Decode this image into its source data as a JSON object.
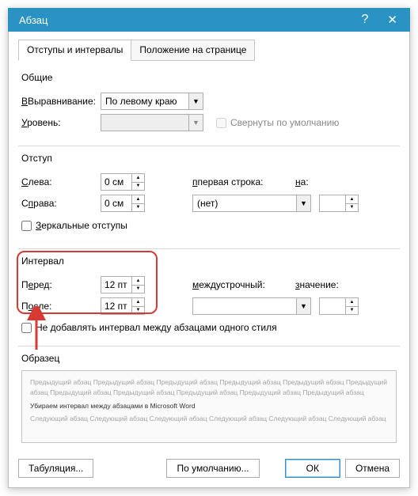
{
  "titlebar": {
    "title": "Абзац"
  },
  "tabs": {
    "t1": "Отступы и интервалы",
    "t2": "Положение на странице"
  },
  "general": {
    "legend": "Общие",
    "align_label": "Выравнивание:",
    "align_u": "В",
    "align_value": "По левому краю",
    "level_label": "ровень:",
    "level_u": "У",
    "level_value": "",
    "collapsed": "Свернуты по умолчанию"
  },
  "indent": {
    "legend": "Отступ",
    "left_label": "лева:",
    "left_u": "С",
    "left_value": "0 см",
    "right_label": "Справа:",
    "right_u": "п",
    "right_value": "0 см",
    "firstline_label": "первая строка:",
    "firstline_u": "п",
    "firstline_value": "(нет)",
    "by_label": "а:",
    "by_u": "н",
    "mirror": "еркальные отступы",
    "mirror_u": "З"
  },
  "spacing": {
    "legend": "Интервал",
    "before_label": "Перед:",
    "before_u": "е",
    "before_value": "12 пт",
    "after_label": "После:",
    "after_u": "о",
    "after_value": "12 пт",
    "line_label": "еждустрочный:",
    "line_u": "м",
    "line_value": "",
    "at_label": "начение:",
    "at_u": "з",
    "nodbl": "Не добавлять интервал между абзацами одного стиля"
  },
  "preview": {
    "legend": "Образец",
    "prev": "Предыдущий абзац Предыдущий абзац Предыдущий абзац Предыдущий абзац Предыдущий абзац Предыдущий абзац Предыдущий абзац Предыдущий абзац Предыдущий абзац Предыдущий абзац Предыдущий абзац",
    "curr": "Убираем интервал между абзацами в Microsoft Word",
    "next": "Следующий абзац Следующий абзац Следующий абзац Следующий абзац Следующий абзац Следующий абзац"
  },
  "footer": {
    "tabs": "Табуляция...",
    "default": "По умолчанию...",
    "ok": "ОК",
    "cancel": "Отмена"
  }
}
